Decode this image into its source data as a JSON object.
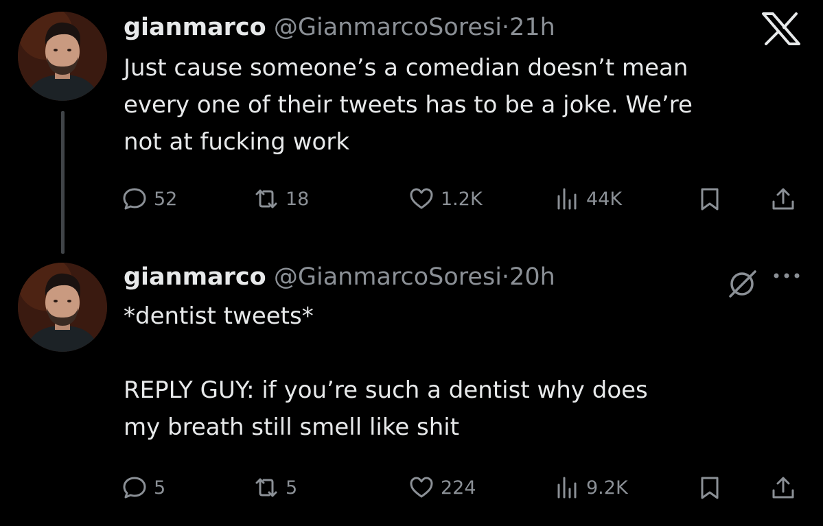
{
  "tweets": [
    {
      "name": "gianmarco",
      "handle": "@GianmarcoSoresi",
      "separator": "·",
      "time": "21h",
      "text": "Just cause someone’s a comedian doesn’t mean\nevery one of their tweets has to be a joke. We’re\nnot at fucking work",
      "replies": "52",
      "retweets": "18",
      "likes": "1.2K",
      "views": "44K"
    },
    {
      "name": "gianmarco",
      "handle": "@GianmarcoSoresi",
      "separator": "·",
      "time": "20h",
      "text": "*dentist tweets*\n\nREPLY GUY: if you’re such a dentist why does\nmy breath still smell like shit",
      "replies": "5",
      "retweets": "5",
      "likes": "224",
      "views": "9.2K"
    }
  ],
  "icons": {
    "brand": "x-logo-icon",
    "reply": "speech-bubble-icon",
    "retweet": "retweet-arrows-icon",
    "like": "heart-icon",
    "views": "bar-chart-icon",
    "bookmark": "bookmark-icon",
    "share": "share-upload-icon",
    "grok": "grok-slash-circle-icon",
    "more": "ellipsis-icon"
  },
  "colors": {
    "background": "#000000",
    "text": "#e7e9ea",
    "secondary": "#8b9096",
    "thread_line": "#404448"
  }
}
